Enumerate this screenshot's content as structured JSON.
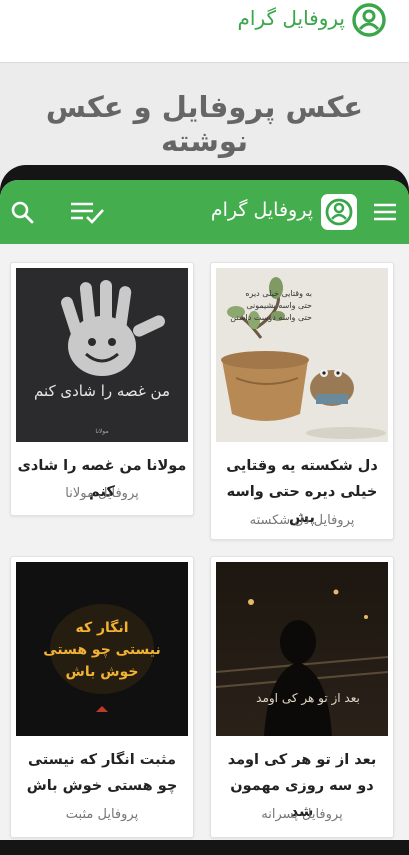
{
  "header": {
    "title": "پروفایل گرام"
  },
  "banner": {
    "title": "عکس پروفایل و عکس نوشته"
  },
  "app": {
    "title": "پروفایل گرام"
  },
  "cards": [
    {
      "title": "دل شکسته یه وقتایی خیلی دیره حتی واسه پش",
      "subtitle": "پروفایل دل شکسته",
      "caption_lines": [
        "به وقتایی خیلی دیره",
        "حتی واسه پشیمونی",
        "حتی واسه دوست داشتن"
      ]
    },
    {
      "title": "مولانا من غصه را شادی کنم",
      "subtitle": "پروفایل مولانا",
      "art_text": "من غصه را شادی کنم",
      "art_sub": "مولانا"
    },
    {
      "title": "بعد از تو هر کی اومد دو سه روزی مهمون شد",
      "subtitle": "پروفایل پسرانه",
      "art_text": "بعد از تو هر کی اومد"
    },
    {
      "title": "مثبت انگار که نیستی چو هستی خوش باش",
      "subtitle": "پروفایل مثبت",
      "art_text": "انگار که نیستی چو هستی خوش باش"
    }
  ],
  "colors": {
    "brand_green": "#44ad4d",
    "header_green": "#3aa64a"
  },
  "icons": [
    "profile-logo-icon",
    "menu-icon",
    "search-icon",
    "filter-list-icon"
  ]
}
